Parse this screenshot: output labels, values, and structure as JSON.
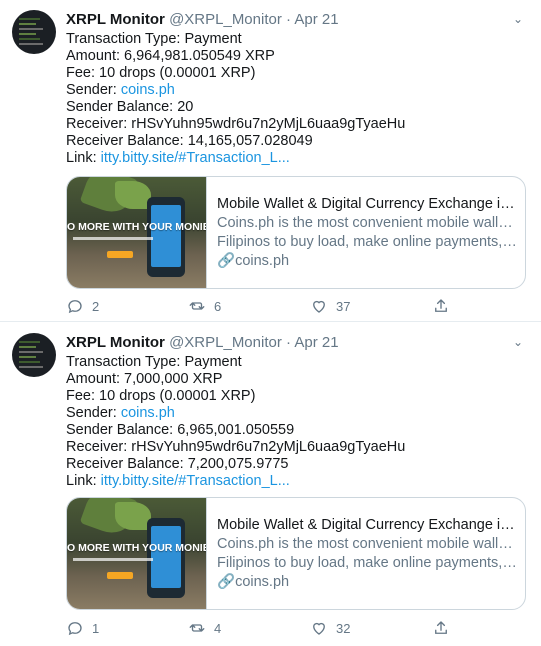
{
  "colors": {
    "link": "#1b95e0",
    "muted": "#657786",
    "text": "#14171a",
    "border": "#ccd6dd"
  },
  "tweets": [
    {
      "name": "XRPL Monitor",
      "handle": "@XRPL_Monitor",
      "date": "· Apr 21",
      "type": "Transaction Type: Payment",
      "amount": "Amount: 6,964,981.050549 XRP",
      "fee": "Fee: 10 drops (0.00001 XRP)",
      "sender_label": "Sender: ",
      "sender": "coins.ph",
      "sender_balance": "Sender Balance: 20",
      "receiver": "Receiver: rHSvYuhn95wdr6u7n2yMjL6uaa9gTyaeHu",
      "receiver_balance": "Receiver Balance: 14,165,057.028049",
      "link_label": "Link: ",
      "link": "itty.bitty.site/#Transaction_L...",
      "card": {
        "promo": "O MORE WITH YOUR MONIE",
        "title": "Mobile Wallet & Digital Currency Exchange in the Phi...",
        "desc1": "Coins.ph is the most convenient mobile wallet for",
        "desc2": "Filipinos to buy load, make online payments, and tra...",
        "domain": "coins.ph"
      },
      "replies": "2",
      "retweets": "6",
      "likes": "37"
    },
    {
      "name": "XRPL Monitor",
      "handle": "@XRPL_Monitor",
      "date": "· Apr 21",
      "type": "Transaction Type: Payment",
      "amount": "Amount: 7,000,000 XRP",
      "fee": "Fee: 10 drops (0.00001 XRP)",
      "sender_label": "Sender: ",
      "sender": "coins.ph",
      "sender_balance": "Sender Balance: 6,965,001.050559",
      "receiver": "Receiver: rHSvYuhn95wdr6u7n2yMjL6uaa9gTyaeHu",
      "receiver_balance": "Receiver Balance: 7,200,075.9775",
      "link_label": "Link: ",
      "link": "itty.bitty.site/#Transaction_L...",
      "card": {
        "promo": "O MORE WITH YOUR MONIE",
        "title": "Mobile Wallet & Digital Currency Exchange in the Phi...",
        "desc1": "Coins.ph is the most convenient mobile wallet for",
        "desc2": "Filipinos to buy load, make online payments, and tra...",
        "domain": "coins.ph"
      },
      "replies": "1",
      "retweets": "4",
      "likes": "32"
    }
  ]
}
